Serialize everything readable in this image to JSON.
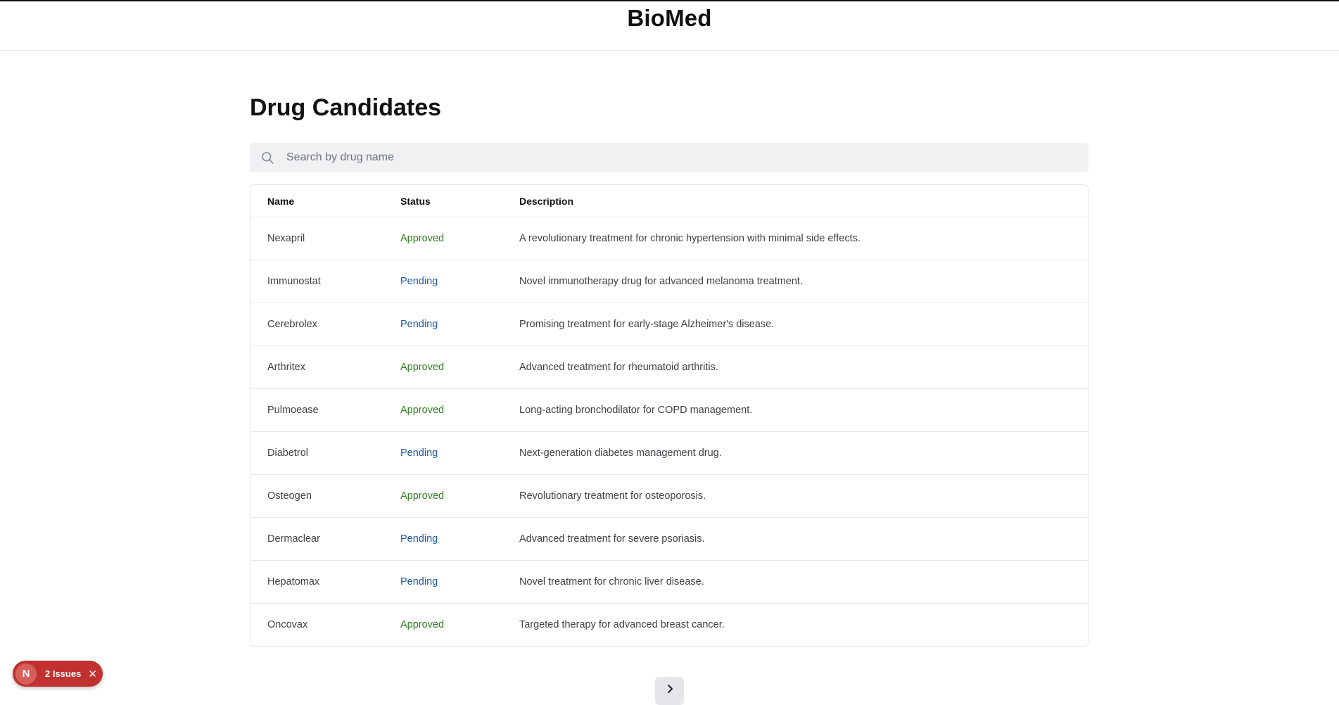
{
  "header": {
    "brand": "BioMed"
  },
  "main": {
    "title": "Drug Candidates",
    "search": {
      "placeholder": "Search by drug name",
      "value": ""
    }
  },
  "table": {
    "columns": {
      "name": "Name",
      "status": "Status",
      "description": "Description"
    },
    "rows": [
      {
        "name": "Nexapril",
        "status": "Approved",
        "description": "A revolutionary treatment for chronic hypertension with minimal side effects."
      },
      {
        "name": "Immunostat",
        "status": "Pending",
        "description": "Novel immunotherapy drug for advanced melanoma treatment."
      },
      {
        "name": "Cerebrolex",
        "status": "Pending",
        "description": "Promising treatment for early-stage Alzheimer's disease."
      },
      {
        "name": "Arthritex",
        "status": "Approved",
        "description": "Advanced treatment for rheumatoid arthritis."
      },
      {
        "name": "Pulmoease",
        "status": "Approved",
        "description": "Long-acting bronchodilator for COPD management."
      },
      {
        "name": "Diabetrol",
        "status": "Pending",
        "description": "Next-generation diabetes management drug."
      },
      {
        "name": "Osteogen",
        "status": "Approved",
        "description": "Revolutionary treatment for osteoporosis."
      },
      {
        "name": "Dermaclear",
        "status": "Pending",
        "description": "Advanced treatment for severe psoriasis."
      },
      {
        "name": "Hepatomax",
        "status": "Pending",
        "description": "Novel treatment for chronic liver disease."
      },
      {
        "name": "Oncovax",
        "status": "Approved",
        "description": "Targeted therapy for advanced breast cancer."
      }
    ]
  },
  "pagination": {
    "next_icon": "chevron-right-icon"
  },
  "issues_badge": {
    "logo_letter": "N",
    "label": "2 Issues",
    "close_icon": "close-icon"
  },
  "colors": {
    "approved": "#2f7d1f",
    "pending": "#1e57a8",
    "badge": "#c0312f"
  }
}
